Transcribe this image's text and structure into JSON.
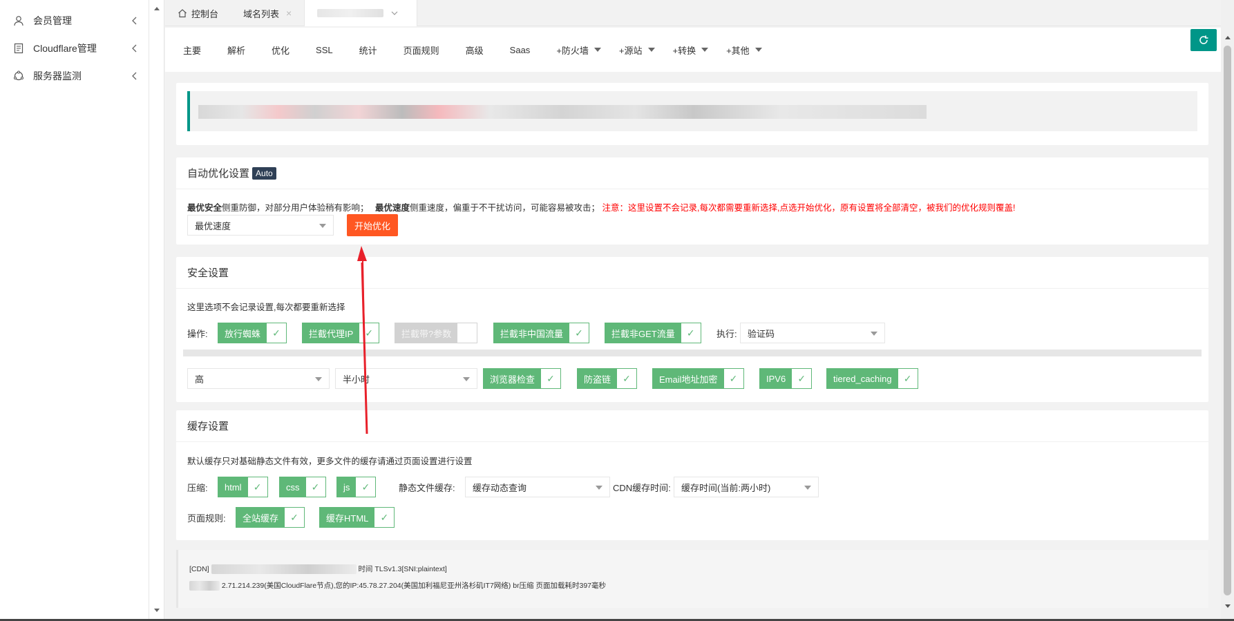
{
  "sidebar": {
    "items": [
      {
        "label": "会员管理",
        "icon": "user-icon"
      },
      {
        "label": "Cloudflare管理",
        "icon": "document-icon"
      },
      {
        "label": "服务器监测",
        "icon": "monitor-icon"
      }
    ]
  },
  "tabs": [
    {
      "label": "控制台",
      "icon": "home-icon"
    },
    {
      "label": "域名列表",
      "close": "×"
    },
    {
      "label": "",
      "dropdown": true
    }
  ],
  "nav": [
    {
      "label": "主要"
    },
    {
      "label": "解析"
    },
    {
      "label": "优化"
    },
    {
      "label": "SSL"
    },
    {
      "label": "统计"
    },
    {
      "label": "页面规则"
    },
    {
      "label": "高级"
    },
    {
      "label": "Saas"
    },
    {
      "label": "+防火墙",
      "caret": true
    },
    {
      "label": "+源站",
      "caret": true
    },
    {
      "label": "+转换",
      "caret": true
    },
    {
      "label": "+其他",
      "caret": true
    }
  ],
  "auto": {
    "title": "自动优化设置",
    "badge": "Auto",
    "desc_b1": "最优安全",
    "desc_t1": "侧重防御，对部分用户体验稍有影响；",
    "desc_b2": "最优速度",
    "desc_t2": "侧重速度，偏重于不干扰访问，可能容易被攻击；",
    "warn": "注意：这里设置不会记录,每次都需要重新选择,点选开始优化，原有设置将全部清空，被我们的优化规则覆盖!",
    "select": "最优速度",
    "start_button": "开始优化"
  },
  "security": {
    "title": "安全设置",
    "note": "这里选项不会记录设置,每次都要重新选择",
    "op_label": "操作:",
    "ops": [
      {
        "label": "放行蜘蛛",
        "on": true
      },
      {
        "label": "拦截代理IP",
        "on": true
      },
      {
        "label": "拦截带?参数",
        "on": false
      },
      {
        "label": "拦截非中国流量",
        "on": true
      },
      {
        "label": "拦截非GET流量",
        "on": true
      }
    ],
    "exec_label": "执行:",
    "exec_select": "验证码",
    "level_select": "高",
    "time_select": "半小时",
    "opts2": [
      {
        "label": "浏览器检查",
        "on": true
      },
      {
        "label": "防盗链",
        "on": true
      },
      {
        "label": "Email地址加密",
        "on": true
      },
      {
        "label": "IPV6",
        "on": true
      },
      {
        "label": "tiered_caching",
        "on": true
      }
    ]
  },
  "cache": {
    "title": "缓存设置",
    "note": "默认缓存只对基础静态文件有效，更多文件的缓存请通过页面设置进行设置",
    "compress_label": "压缩:",
    "compress": [
      {
        "label": "html",
        "on": true
      },
      {
        "label": "css",
        "on": true
      },
      {
        "label": "js",
        "on": true
      }
    ],
    "static_label": "静态文件缓存:",
    "static_select": "缓存动态查询",
    "cdn_label": "CDN缓存时间:",
    "cdn_select": "缓存时间(当前:两小时)",
    "rules_label": "页面规则:",
    "rules": [
      {
        "label": "全站缓存",
        "on": true
      },
      {
        "label": "缓存HTML",
        "on": true
      }
    ]
  },
  "footer": {
    "line1_prefix": "[CDN]",
    "line1_suffix": "时间 TLSv1.3[SNI:plaintext]",
    "line2": "2.71.214.239(美国CloudFlare节点),您的IP:45.78.27.204(美国加利福尼亚州洛杉矶IT7网络) br压缩 页面加载耗时397毫秒"
  },
  "colors": {
    "accent": "#009688",
    "check_green": "#5fb878",
    "start_orange": "#ff5722",
    "warn_red": "#ff0000",
    "badge_dark": "#2f4056",
    "arrow_red": "#e8202a"
  }
}
